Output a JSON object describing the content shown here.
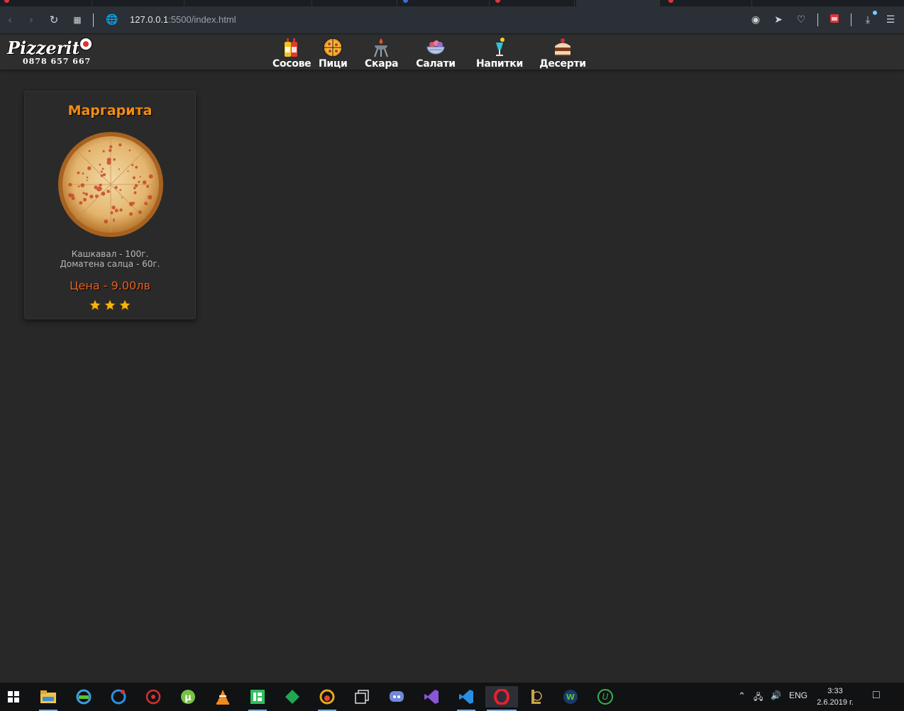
{
  "browser": {
    "url_host": "127.0.0.1",
    "url_path": ":5500/index.html"
  },
  "site": {
    "brand": "Pizzerit",
    "phone": "0878 657 667",
    "menu": [
      {
        "label": "Сосове",
        "icon": "sauce-bottles-icon"
      },
      {
        "label": "Пици",
        "icon": "pizza-icon"
      },
      {
        "label": "Скара",
        "icon": "grill-icon"
      },
      {
        "label": "Салати",
        "icon": "salad-bowl-icon"
      },
      {
        "label": "Напитки",
        "icon": "cocktail-icon"
      },
      {
        "label": "Десерти",
        "icon": "cake-icon"
      }
    ]
  },
  "product": {
    "name": "Маргарита",
    "ingredients": [
      "Кашкавал - 100г.",
      "Доматена салца - 60г."
    ],
    "price": "Цена - 9.00лв",
    "rating": 3,
    "colors": {
      "title": "#f28c16",
      "price": "#e8611f",
      "star": "#f5b50a"
    }
  },
  "taskbar": {
    "language": "ENG",
    "time": "3:33",
    "date": "2.6.2019 г."
  }
}
